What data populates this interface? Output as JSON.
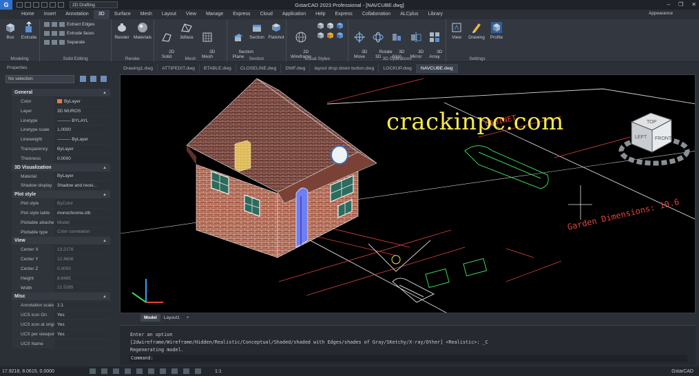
{
  "titlebar": {
    "title": "GstarCAD 2023 Professional - [NAVCUBE.dwg]",
    "workspace": "2D Drafting",
    "logo": "G",
    "window_controls": [
      "–",
      "❐",
      "✕"
    ]
  },
  "menu_tabs": [
    "Home",
    "Insert",
    "Annotation",
    "3D",
    "Surface",
    "Mesh",
    "Layout",
    "View",
    "Manage",
    "Express",
    "Cloud",
    "Application",
    "Help",
    "Express",
    "Collaboration",
    "ALCplus",
    "Library"
  ],
  "active_menu_tab": "3D",
  "appearance": "Appearance",
  "ribbon": {
    "modeling": {
      "title": "Modeling",
      "box": "Box",
      "extrude": "Extrude"
    },
    "solid_editing": {
      "title": "Solid Editing",
      "extract_edges": "Extract Edges",
      "extrude_faces": "Extrude faces",
      "separate": "Separate"
    },
    "render": {
      "title": "Render",
      "render": "Render",
      "materials": "Materials"
    },
    "mesh": {
      "title": "Mesh",
      "solid2d": "2D\nSolid",
      "face3d": "3dface",
      "mesh3d": "3D\nMesh"
    },
    "section": {
      "title": "Section",
      "section_plane": "Section\nPlane",
      "section": "Section",
      "flatshot": "Flatshot"
    },
    "visual_styles": {
      "title": "Visual Styles",
      "wireframe2d": "2D\nWireframe"
    },
    "ops3d": {
      "title": "3D Operations",
      "move": "3D\nMove",
      "rotate": "Rotate\n3D",
      "align": "3D\nAlign",
      "mirror": "3D\nMirror",
      "array": "3D\nArray"
    },
    "settings": {
      "title": "Settings",
      "view": "View",
      "drawing": "Drawing",
      "profile": "Profile"
    }
  },
  "properties": {
    "title": "Properties",
    "selection": "No selection",
    "sections": [
      {
        "name": "General",
        "rows": [
          {
            "k": "Color",
            "v": "ByLayer",
            "swatch": "#e07a4a"
          },
          {
            "k": "Layer",
            "v": "3D MUROS"
          },
          {
            "k": "Linetype",
            "v": "——— BYLAYL"
          },
          {
            "k": "Linetype scale",
            "v": "1.0000"
          },
          {
            "k": "Lineweight",
            "v": "——— ByLayer"
          },
          {
            "k": "Transparency",
            "v": "ByLayer"
          },
          {
            "k": "Thickness",
            "v": "0.0000"
          }
        ]
      },
      {
        "name": "3D Visualization",
        "rows": [
          {
            "k": "Material",
            "v": "ByLayer"
          },
          {
            "k": "Shadow display",
            "v": "Shadow and recei..."
          }
        ]
      },
      {
        "name": "Plot style",
        "rows": [
          {
            "k": "Plot style",
            "v": "ByColor",
            "dim": true
          },
          {
            "k": "Plot style table",
            "v": "monochrome.ctb"
          },
          {
            "k": "Plottable attache...",
            "v": "Model",
            "dim": true
          },
          {
            "k": "Plottable type",
            "v": "Color correlation",
            "dim": true
          }
        ]
      },
      {
        "name": "View",
        "rows": [
          {
            "k": "Center X",
            "v": "13.2178",
            "dim": true
          },
          {
            "k": "Center Y",
            "v": "12.4608",
            "dim": true
          },
          {
            "k": "Center Z",
            "v": "0.0000",
            "dim": true
          },
          {
            "k": "Height",
            "v": "8.8485",
            "dim": true
          },
          {
            "k": "Width",
            "v": "21.5285",
            "dim": true
          }
        ]
      },
      {
        "name": "Misc",
        "rows": [
          {
            "k": "Annotation scale",
            "v": "1:1"
          },
          {
            "k": "UCS icon On",
            "v": "Yes"
          },
          {
            "k": "UCS icon at origin",
            "v": "Yes"
          },
          {
            "k": "UCS per viewport",
            "v": "Yes"
          },
          {
            "k": "UCS Name",
            "v": ""
          }
        ]
      }
    ]
  },
  "doc_tabs": [
    "Drawing1.dwg",
    "ATTIPEDIT.dwg",
    "BTABLE.dwg",
    "CLOSELINE.dwg",
    "DWF.dwg",
    "layout drop down button.dwg",
    "LOCKUP.dwg",
    "NAVCUBE.dwg"
  ],
  "active_doc_tab": "NAVCUBE.dwg",
  "watermark": "crackinpc.com",
  "navcube": {
    "top": "TOP",
    "left": "LEFT",
    "front": "FRONT"
  },
  "drawing_text": {
    "garden": "Garden Dimensions: 10.6",
    "cabinet": "CABINET"
  },
  "layout_tabs": [
    "Model",
    "Layout1",
    "+"
  ],
  "active_layout_tab": "Model",
  "command": {
    "lines": [
      "Enter an option",
      "[2dwireframe/Wireframe/Hidden/Realistic/Conceptual/Shaded/shaded with Edges/shades of Gray/SKetchy/X-ray/Other] <Realistic>: _C",
      "Regenerating model."
    ],
    "prompt": "Command:"
  },
  "status": {
    "coords": "17.9218, 8.0615, 0.0000",
    "brand": "GstarCAD",
    "scale": "1:1"
  }
}
